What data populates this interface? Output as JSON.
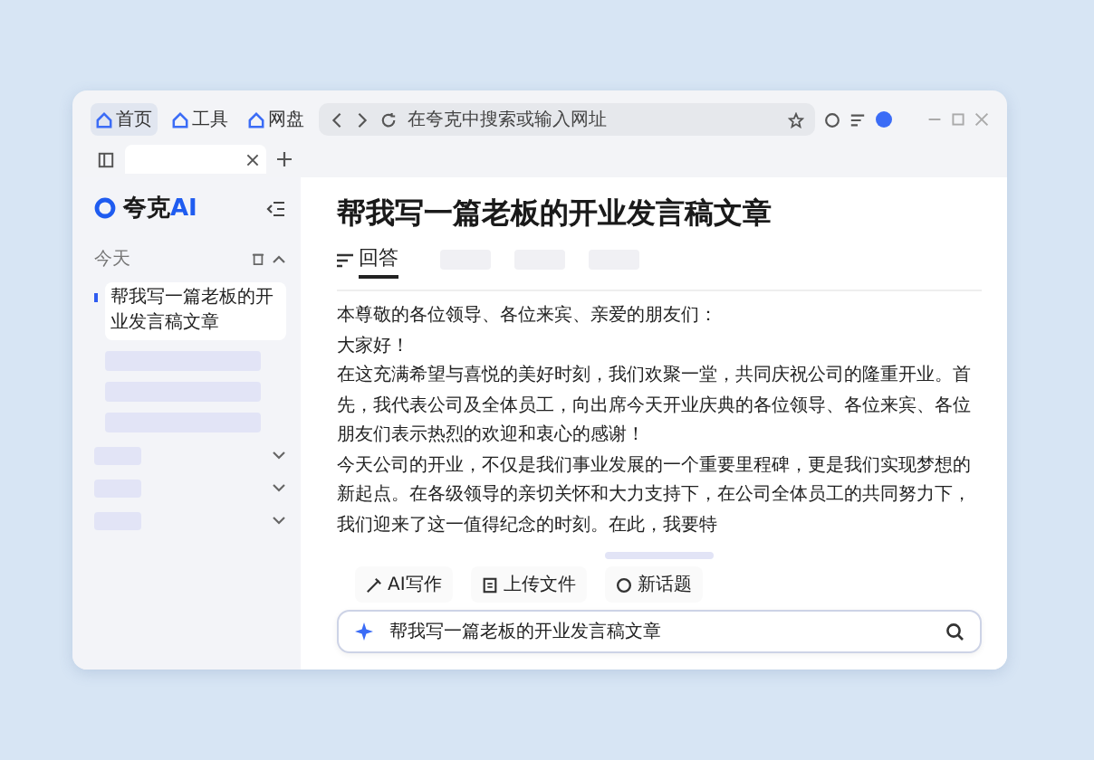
{
  "browser": {
    "nav_tabs": [
      {
        "label": "首页",
        "selected": true
      },
      {
        "label": "工具",
        "selected": false
      },
      {
        "label": "网盘",
        "selected": false
      }
    ],
    "address_placeholder": "在夸克中搜索或输入网址"
  },
  "sidebar": {
    "logo_text": "夸克",
    "logo_accent": "AI",
    "section": "今天",
    "history": [
      {
        "label": "帮我写一篇老板的开业发言稿文章",
        "selected": true
      }
    ]
  },
  "main": {
    "title": "帮我写一篇老板的开业发言稿文章",
    "tabs": [
      {
        "label": "回答",
        "selected": true
      }
    ],
    "paragraphs": [
      "本尊敬的各位领导、各位来宾、亲爱的朋友们：",
      "大家好！",
      "在这充满希望与喜悦的美好时刻，我们欢聚一堂，共同庆祝公司的隆重开业。首先，我代表公司及全体员工，向出席今天开业庆典的各位领导、各位来宾、各位朋友们表示热烈的欢迎和衷心的感谢！",
      "今天公司的开业，不仅是我们事业发展的一个重要里程碑，更是我们实现梦想的新起点。在各级领导的亲切关怀和大力支持下，在公司全体员工的共同努力下，我们迎来了这一值得纪念的时刻。在此，我要特"
    ],
    "actions": [
      {
        "kind": "pen",
        "label": "AI写作"
      },
      {
        "kind": "upload",
        "label": "上传文件"
      },
      {
        "kind": "new",
        "label": "新话题"
      }
    ],
    "input_value": "帮我写一篇老板的开业发言稿文章"
  }
}
